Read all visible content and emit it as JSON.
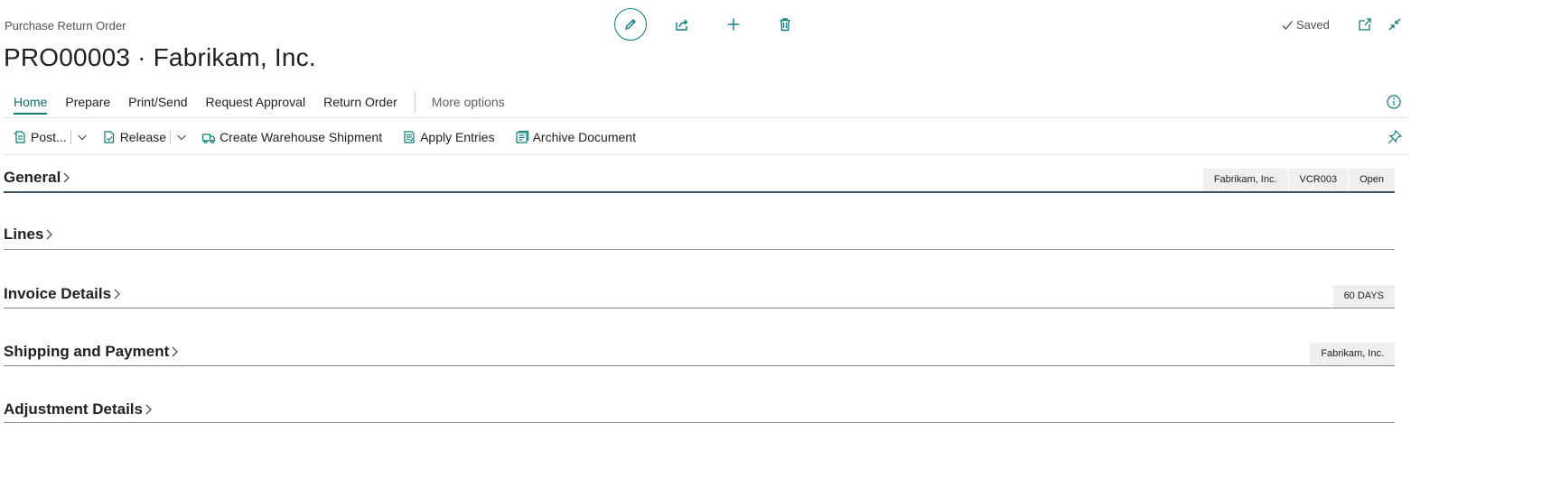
{
  "header": {
    "caption": "Purchase Return Order",
    "title": "PRO00003 · Fabrikam, Inc.",
    "saved_label": "Saved",
    "toolbar_icons": [
      "edit-icon",
      "share-icon",
      "new-icon",
      "delete-icon"
    ]
  },
  "tabs": [
    {
      "label": "Home",
      "active": true
    },
    {
      "label": "Prepare",
      "active": false
    },
    {
      "label": "Print/Send",
      "active": false
    },
    {
      "label": "Request Approval",
      "active": false
    },
    {
      "label": "Return Order",
      "active": false
    }
  ],
  "more_options": "More options",
  "actions": {
    "post": "Post...",
    "release": "Release",
    "create_warehouse_shipment": "Create Warehouse Shipment",
    "apply_entries": "Apply Entries",
    "archive_document": "Archive Document"
  },
  "sections": {
    "general": {
      "title": "General",
      "badges": [
        "Fabrikam, Inc.",
        "VCR003",
        "Open"
      ]
    },
    "lines": {
      "title": "Lines"
    },
    "invoice_details": {
      "title": "Invoice Details",
      "badges": [
        "60 DAYS"
      ]
    },
    "shipping_payment": {
      "title": "Shipping and Payment",
      "badges": [
        "Fabrikam, Inc."
      ]
    },
    "adjustment_details": {
      "title": "Adjustment Details"
    }
  },
  "colors": {
    "accent": "#0f7b7b",
    "badge_bg": "#efefef",
    "text": "#212121"
  }
}
